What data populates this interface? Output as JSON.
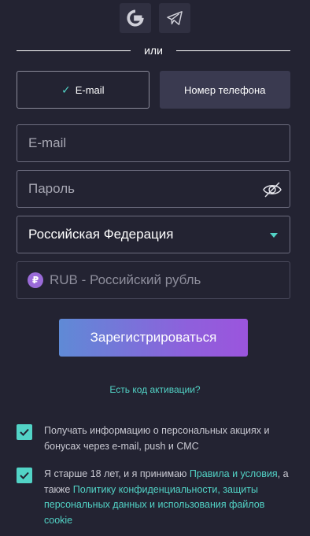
{
  "social": {
    "google_label": "G",
    "telegram_label": "Telegram"
  },
  "divider": {
    "text": "или"
  },
  "tabs": [
    {
      "label": "E-mail",
      "active": true
    },
    {
      "label": "Номер телефона",
      "active": false
    }
  ],
  "form": {
    "email_placeholder": "E-mail",
    "password_placeholder": "Пароль",
    "country_value": "Российская Федерация",
    "currency_symbol": "₽",
    "currency_value": "RUB - Российский рубль"
  },
  "submit_label": "Зарегистрироваться",
  "promo_link": "Есть код активации?",
  "consents": {
    "marketing": {
      "checked": true,
      "text": "Получать информацию о персональных акциях и бонусах через e-mail, push и СМС"
    },
    "terms": {
      "checked": true,
      "text_before": "Я старше 18 лет, и я принимаю ",
      "link_rules": "Правила и условия",
      "text_middle": ", а также ",
      "link_privacy": "Политику конфиденциальности, защиты персональных данных и использования файлов cookie"
    }
  },
  "colors": {
    "background": "#232332",
    "accent": "#52d3c6",
    "button_gradient_start": "#5f8ad6",
    "button_gradient_end": "#9b55dd"
  }
}
